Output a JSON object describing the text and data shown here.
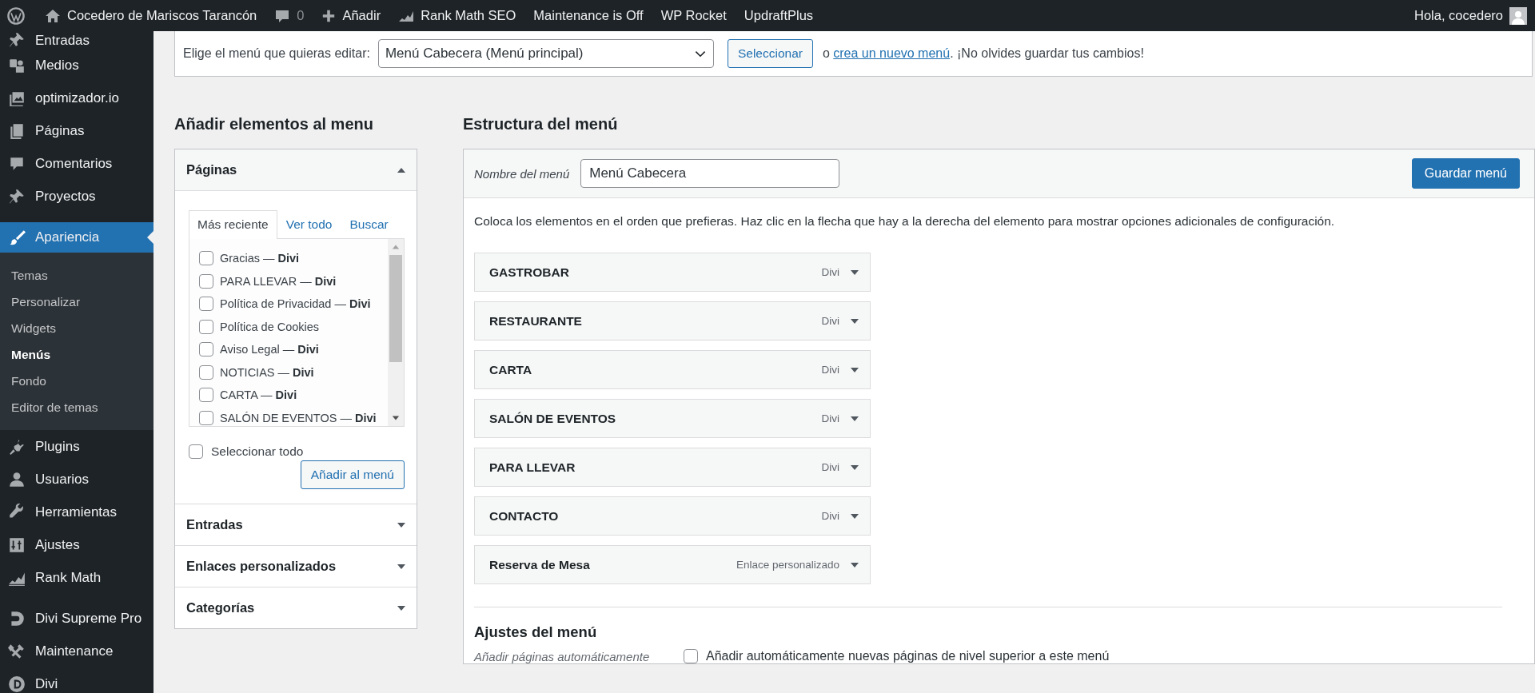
{
  "admin_bar": {
    "items": [
      {
        "kind": "logo"
      },
      {
        "kind": "site",
        "label": "Cocedero de Mariscos Tarancón"
      },
      {
        "kind": "comments",
        "label": "0"
      },
      {
        "kind": "new",
        "label": "Añadir"
      },
      {
        "kind": "seo",
        "label": "Rank Math SEO"
      },
      {
        "kind": "text",
        "label": "Maintenance is Off"
      },
      {
        "kind": "text",
        "label": "WP Rocket"
      },
      {
        "kind": "text",
        "label": "UpdraftPlus"
      }
    ],
    "greeting": "Hola, cocedero"
  },
  "sidebar": {
    "items": [
      {
        "label": "Entradas",
        "kind": "pin",
        "selected": false
      },
      {
        "label": "Medios",
        "kind": "media",
        "selected": false
      },
      {
        "label": "optimizador.io",
        "kind": "images",
        "selected": false
      },
      {
        "label": "Páginas",
        "kind": "pages",
        "selected": false
      },
      {
        "label": "Comentarios",
        "kind": "comment",
        "selected": false
      },
      {
        "label": "Proyectos",
        "kind": "pin",
        "selected": false
      },
      {
        "label": "Apariencia",
        "kind": "brush",
        "selected": true,
        "children": [
          {
            "label": "Temas",
            "selected": false
          },
          {
            "label": "Personalizar",
            "selected": false
          },
          {
            "label": "Widgets",
            "selected": false
          },
          {
            "label": "Menús",
            "selected": true
          },
          {
            "label": "Fondo",
            "selected": false
          },
          {
            "label": "Editor de temas",
            "selected": false
          }
        ]
      },
      {
        "label": "Plugins",
        "kind": "plug",
        "selected": false
      },
      {
        "label": "Usuarios",
        "kind": "user",
        "selected": false
      },
      {
        "label": "Herramientas",
        "kind": "wrench",
        "selected": false
      },
      {
        "label": "Ajustes",
        "kind": "sliders",
        "selected": false
      },
      {
        "label": "Rank Math",
        "kind": "seo",
        "selected": false
      },
      {
        "label": "Divi Supreme Pro",
        "kind": "dlogo",
        "selected": false
      },
      {
        "label": "Maintenance",
        "kind": "tools",
        "selected": false
      },
      {
        "label": "Divi",
        "kind": "dcircle",
        "selected": false
      }
    ]
  },
  "menu_select": {
    "label": "Elige el menú que quieras editar:",
    "value": "Menú Cabecera (Menú principal)",
    "button": "Seleccionar",
    "note_prefix": "o",
    "note_link": "crea un nuevo menú",
    "note_suffix": ". ¡No olvides guardar tus cambios!"
  },
  "add_items": {
    "title": "Añadir elementos al menu",
    "panels": [
      {
        "title": "Páginas",
        "expanded": true,
        "tabs": [
          {
            "label": "Más reciente",
            "selected": true
          },
          {
            "label": "Ver todo",
            "selected": false
          },
          {
            "label": "Buscar",
            "selected": false
          }
        ],
        "pages": [
          {
            "label": "Gracias — **Divi**",
            "checked": false
          },
          {
            "label": "PARA LLEVAR — **Divi**",
            "checked": false
          },
          {
            "label": "Política de Privacidad — **Divi**",
            "checked": false
          },
          {
            "label": "Política de Cookies",
            "checked": false
          },
          {
            "label": "Aviso Legal — **Divi**",
            "checked": false
          },
          {
            "label": "NOTICIAS — **Divi**",
            "checked": false
          },
          {
            "label": "CARTA — **Divi**",
            "checked": false
          },
          {
            "label": "SALÓN DE EVENTOS — **Divi**",
            "checked": false
          }
        ],
        "select_all": {
          "label": "Seleccionar todo",
          "checked": false
        },
        "button": "Añadir al menú"
      },
      {
        "title": "Entradas",
        "expanded": false
      },
      {
        "title": "Enlaces personalizados",
        "expanded": false
      },
      {
        "title": "Categorías",
        "expanded": false
      }
    ]
  },
  "structure": {
    "title": "Estructura del menú",
    "name_label": "Nombre del menú",
    "name_value": "Menú Cabecera",
    "save_button": "Guardar menú",
    "instructions": "Coloca los elementos en el orden que prefieras. Haz clic en la flecha que hay a la derecha del elemento para mostrar opciones adicionales de configuración.",
    "items": [
      {
        "title": "GASTROBAR",
        "type": "Divi"
      },
      {
        "title": "RESTAURANTE",
        "type": "Divi"
      },
      {
        "title": "CARTA",
        "type": "Divi"
      },
      {
        "title": "SALÓN DE EVENTOS",
        "type": "Divi"
      },
      {
        "title": "PARA LLEVAR",
        "type": "Divi"
      },
      {
        "title": "CONTACTO",
        "type": "Divi"
      },
      {
        "title": "Reserva de Mesa",
        "type": "Enlace personalizado"
      }
    ],
    "settings_title": "Ajustes del menú",
    "settings": [
      {
        "label": "Añadir páginas automáticamente",
        "option": "Añadir automáticamente nuevas páginas de nivel superior a este menú",
        "checked": false
      }
    ]
  }
}
